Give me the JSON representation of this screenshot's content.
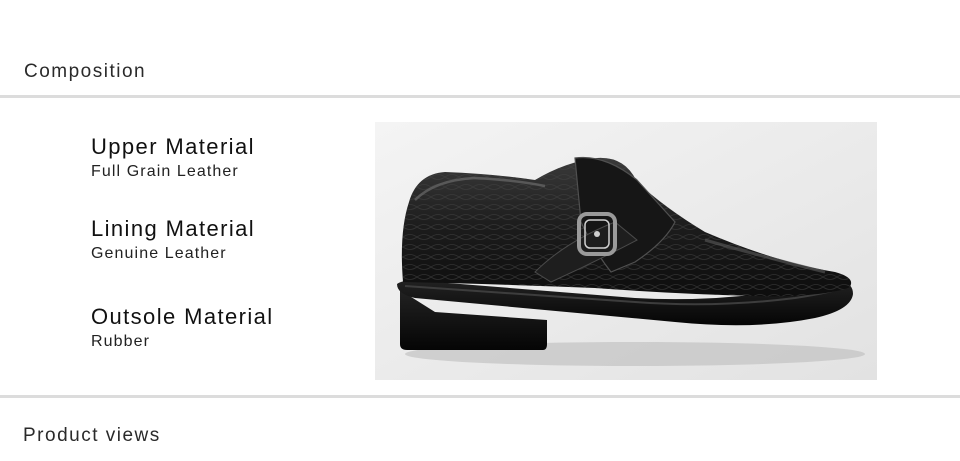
{
  "composition_heading": "Composition",
  "specs": [
    {
      "title": "Upper Material",
      "value": "Full Grain Leather"
    },
    {
      "title": "Lining Material",
      "value": "Genuine Leather"
    },
    {
      "title": "Outsole Material",
      "value": "Rubber"
    }
  ],
  "product_image": {
    "subject": "black-monk-strap-shoe",
    "background": "#ececec"
  },
  "product_views_heading": "Product views",
  "colors": {
    "rule": "#dcdcdc",
    "text": "#1a1a1a",
    "shoe": "#141414"
  }
}
